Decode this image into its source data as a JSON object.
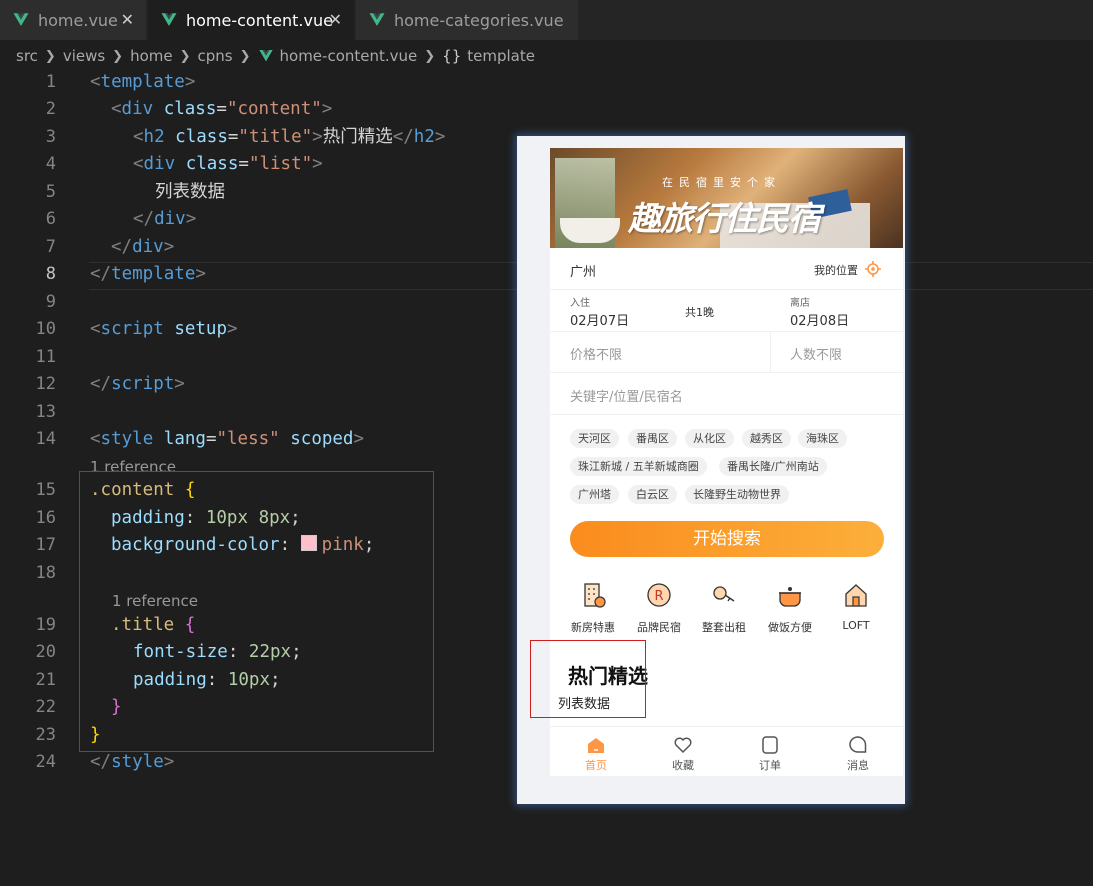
{
  "tabs": [
    {
      "label": "home.vue",
      "close": "✕",
      "active": false
    },
    {
      "label": "home-content.vue",
      "close": "✕",
      "active": true
    },
    {
      "label": "home-categories.vue",
      "close": "",
      "active": false
    }
  ],
  "breadcrumb": {
    "items": [
      "src",
      "views",
      "home",
      "cpns",
      "home-content.vue",
      "template"
    ],
    "braces": "{}"
  },
  "code": {
    "line_numbers": [
      "1",
      "2",
      "3",
      "4",
      "5",
      "6",
      "7",
      "8",
      "9",
      "10",
      "11",
      "12",
      "13",
      "14",
      "15",
      "16",
      "17",
      "18",
      "19",
      "20",
      "21",
      "22",
      "23",
      "24"
    ],
    "references": [
      "1 reference",
      "1 reference"
    ],
    "l1": {
      "lt": "<",
      "tag": "template",
      "gt": ">"
    },
    "l2": {
      "lt": "<",
      "tag": "div",
      "attr": "class",
      "eq": "=",
      "val": "\"content\"",
      "gt": ">"
    },
    "l3": {
      "lt": "<",
      "tag": "h2",
      "attr": "class",
      "eq": "=",
      "val": "\"title\"",
      "gt": ">",
      "text": "热门精选",
      "close_lt": "</",
      "close_tag": "h2",
      "close_gt": ">"
    },
    "l4": {
      "lt": "<",
      "tag": "div",
      "attr": "class",
      "eq": "=",
      "val": "\"list\"",
      "gt": ">"
    },
    "l5": {
      "text": "列表数据"
    },
    "l6": {
      "lt": "</",
      "tag": "div",
      "gt": ">"
    },
    "l7": {
      "lt": "</",
      "tag": "div",
      "gt": ">"
    },
    "l8": {
      "lt": "</",
      "tag": "template",
      "gt": ">"
    },
    "l10": {
      "lt": "<",
      "tag": "script",
      "attr": "setup",
      "gt": ">"
    },
    "l12": {
      "lt": "</",
      "tag": "script",
      "gt": ">"
    },
    "l14": {
      "lt": "<",
      "tag": "style",
      "attr": "lang",
      "eq": "=",
      "val": "\"less\"",
      "attr2": "scoped",
      "gt": ">"
    },
    "l15": {
      "sel": ".content",
      "brace": "{"
    },
    "l16": {
      "prop": "padding",
      "colon": ":",
      "v1": "10px",
      "v2": "8px",
      "semi": ";"
    },
    "l17": {
      "prop": "background-color",
      "colon": ":",
      "val": "pink",
      "semi": ";"
    },
    "l19": {
      "sel": ".title",
      "brace": "{"
    },
    "l20": {
      "prop": "font-size",
      "colon": ":",
      "val": "22px",
      "semi": ";"
    },
    "l21": {
      "prop": "padding",
      "colon": ":",
      "val": "10px",
      "semi": ";"
    },
    "l22": {
      "brace": "}"
    },
    "l23": {
      "brace": "}"
    },
    "l24": {
      "lt": "</",
      "tag": "style",
      "gt": ">"
    }
  },
  "preview": {
    "banner": {
      "subtitle": "在民宿里安个家",
      "title": "趣旅行住民宿"
    },
    "city": "广州",
    "my_location": "我的位置",
    "checkin_label": "入住",
    "checkin_date": "02月07日",
    "nights": "共1晚",
    "checkout_label": "离店",
    "checkout_date": "02月08日",
    "price": "价格不限",
    "people": "人数不限",
    "keyword_placeholder": "关键字/位置/民宿名",
    "hot_suggests": [
      "天河区",
      "番禺区",
      "从化区",
      "越秀区",
      "海珠区",
      "珠江新城 / 五羊新城商圈",
      "番禺长隆/广州南站",
      "广州塔",
      "白云区",
      "长隆野生动物世界"
    ],
    "search_button": "开始搜索",
    "categories": [
      {
        "label": "新房特惠",
        "icon": "building-icon"
      },
      {
        "label": "品牌民宿",
        "icon": "brand-icon"
      },
      {
        "label": "整套出租",
        "icon": "key-icon"
      },
      {
        "label": "做饭方便",
        "icon": "pot-icon"
      },
      {
        "label": "LOFT",
        "icon": "house-icon"
      }
    ],
    "hot_title": "热门精选",
    "hot_list": "列表数据",
    "tabbar": [
      {
        "label": "首页",
        "icon": "home-icon",
        "active": true
      },
      {
        "label": "收藏",
        "icon": "heart-icon",
        "active": false
      },
      {
        "label": "订单",
        "icon": "order-icon",
        "active": false
      },
      {
        "label": "消息",
        "icon": "message-icon",
        "active": false
      }
    ]
  },
  "colors": {
    "editor_bg": "#1e1e1e",
    "accent_orange": "#ff9645",
    "vue_green": "#41b883",
    "pink": "#ffc0cb",
    "highlight_red": "#d01c1c"
  }
}
